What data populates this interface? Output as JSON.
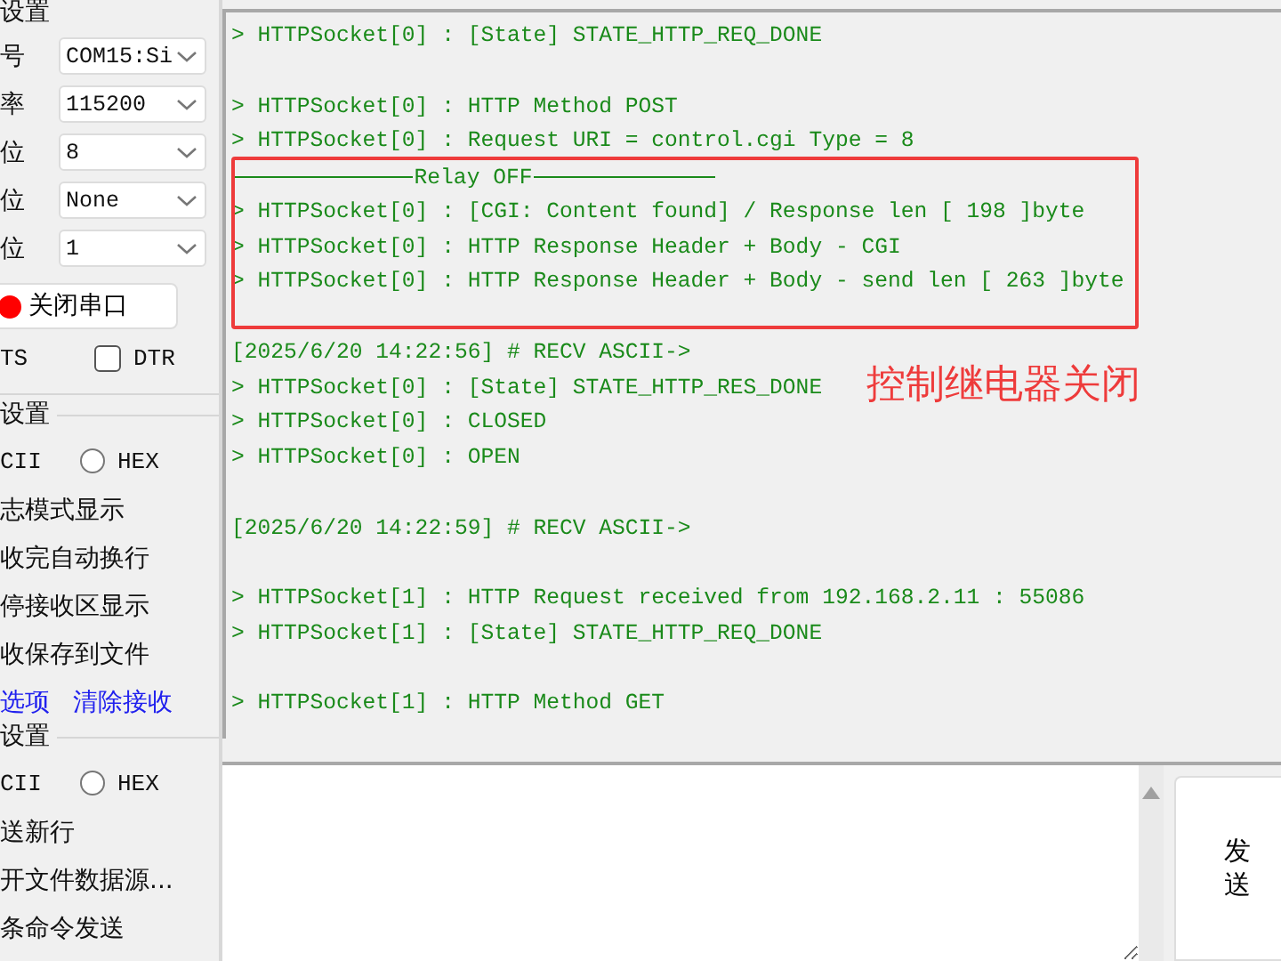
{
  "serial_settings": {
    "heading": "设置",
    "fields": [
      {
        "label": "号",
        "value": "COM15:Si"
      },
      {
        "label": "率",
        "value": "115200"
      },
      {
        "label": "位",
        "value": "8"
      },
      {
        "label": "位",
        "value": "None"
      },
      {
        "label": "位",
        "value": "1"
      }
    ]
  },
  "port_button": {
    "label": "关闭串口",
    "open": true
  },
  "rts_label": "TS",
  "dtr": {
    "label": "DTR",
    "checked": false
  },
  "receive_settings": {
    "heading": "设置",
    "ascii_label": "CII",
    "hex": {
      "label": "HEX",
      "selected": false
    },
    "options": [
      "志模式显示",
      "收完自动换行",
      "停接收区显示",
      "收保存到文件"
    ],
    "links": [
      "选项",
      "清除接收"
    ]
  },
  "send_settings": {
    "heading": "设置",
    "ascii_label": "CII",
    "hex": {
      "label": "HEX",
      "selected": false
    },
    "options": [
      "送新行",
      "开文件数据源...",
      "条命令发送"
    ]
  },
  "log": {
    "lines": [
      {
        "kind": "text",
        "text": "> HTTPSocket[0] : [State] STATE_HTTP_REQ_DONE"
      },
      {
        "kind": "blank"
      },
      {
        "kind": "text",
        "text": "> HTTPSocket[0] : HTTP Method POST"
      },
      {
        "kind": "text",
        "text": "> HTTPSocket[0] : Request URI = control.cgi Type = 8"
      },
      {
        "kind": "separator",
        "text": "Relay OFF"
      },
      {
        "kind": "text",
        "text": "> HTTPSocket[0] : [CGI: Content found] / Response len [ 198 ]byte"
      },
      {
        "kind": "text",
        "text": "> HTTPSocket[0] : HTTP Response Header + Body - CGI"
      },
      {
        "kind": "text",
        "text": "> HTTPSocket[0] : HTTP Response Header + Body - send len [ 263 ]byte"
      },
      {
        "kind": "blank"
      },
      {
        "kind": "text",
        "text": "[2025/6/20 14:22:56] # RECV ASCII->"
      },
      {
        "kind": "text",
        "text": "> HTTPSocket[0] : [State] STATE_HTTP_RES_DONE"
      },
      {
        "kind": "text",
        "text": "> HTTPSocket[0] : CLOSED"
      },
      {
        "kind": "text",
        "text": "> HTTPSocket[0] : OPEN"
      },
      {
        "kind": "blank"
      },
      {
        "kind": "text",
        "text": "[2025/6/20 14:22:59] # RECV ASCII->"
      },
      {
        "kind": "blank"
      },
      {
        "kind": "text",
        "text": "> HTTPSocket[1] : HTTP Request received from 192.168.2.11 : 55086"
      },
      {
        "kind": "text",
        "text": "> HTTPSocket[1] : [State] STATE_HTTP_REQ_DONE"
      },
      {
        "kind": "blank"
      },
      {
        "kind": "text",
        "text": "> HTTPSocket[1] : HTTP Method GET"
      }
    ]
  },
  "annotation": {
    "text": "控制继电器关闭"
  },
  "send_button": "发送"
}
